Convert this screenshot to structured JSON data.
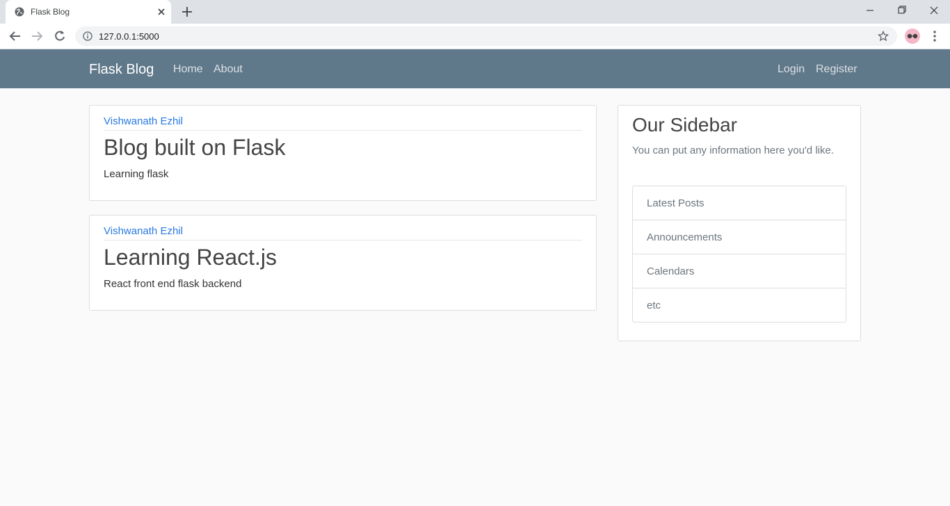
{
  "browser": {
    "tab_title": "Flask Blog",
    "url": "127.0.0.1:5000"
  },
  "site": {
    "brand": "Flask Blog",
    "nav_left": [
      "Home",
      "About"
    ],
    "nav_right": [
      "Login",
      "Register"
    ],
    "nav_color": "#5f788a"
  },
  "posts": [
    {
      "author": "Vishwanath Ezhil",
      "title": "Blog built on Flask",
      "content": "Learning flask"
    },
    {
      "author": "Vishwanath Ezhil",
      "title": "Learning React.js",
      "content": "React front end flask backend"
    }
  ],
  "sidebar": {
    "title": "Our Sidebar",
    "text": "You can put any information here you'd like.",
    "items": [
      "Latest Posts",
      "Announcements",
      "Calendars",
      "etc"
    ]
  }
}
